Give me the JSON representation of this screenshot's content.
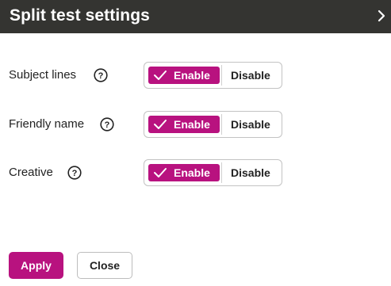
{
  "panel": {
    "title": "Split test settings",
    "collapse_icon": "chevron-right-icon"
  },
  "settings": [
    {
      "label": "Subject lines",
      "help_icon": "help-icon",
      "enable_label": "Enable",
      "disable_label": "Disable",
      "selected": "Enable"
    },
    {
      "label": "Friendly name",
      "help_icon": "help-icon",
      "enable_label": "Enable",
      "disable_label": "Disable",
      "selected": "Enable"
    },
    {
      "label": "Creative",
      "help_icon": "help-icon",
      "enable_label": "Enable",
      "disable_label": "Disable",
      "selected": "Enable"
    }
  ],
  "footer": {
    "apply_label": "Apply",
    "close_label": "Close"
  },
  "colors": {
    "header_bg": "#343431",
    "accent": "#b8127f"
  }
}
